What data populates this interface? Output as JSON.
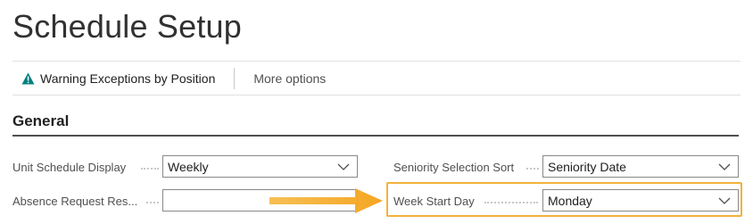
{
  "page": {
    "title": "Schedule Setup"
  },
  "toolbar": {
    "warning_label": "Warning Exceptions by Position",
    "more_label": "More options"
  },
  "section": {
    "title": "General"
  },
  "fields": {
    "unit_schedule_display": {
      "label": "Unit Schedule Display",
      "value": "Weekly"
    },
    "absence_request_res": {
      "label": "Absence Request Res...",
      "value": ""
    },
    "seniority_selection_sort": {
      "label": "Seniority Selection Sort",
      "value": "Seniority Date"
    },
    "week_start_day": {
      "label": "Week Start Day",
      "value": "Monday"
    }
  },
  "colors": {
    "accent_teal": "#00807f",
    "highlight": "#f2b33d",
    "arrow": "#f5b335"
  },
  "icons": {
    "warning": "warning-icon",
    "dropdown": "chevron-down-icon",
    "annotation_arrow": "arrow-right-icon"
  }
}
